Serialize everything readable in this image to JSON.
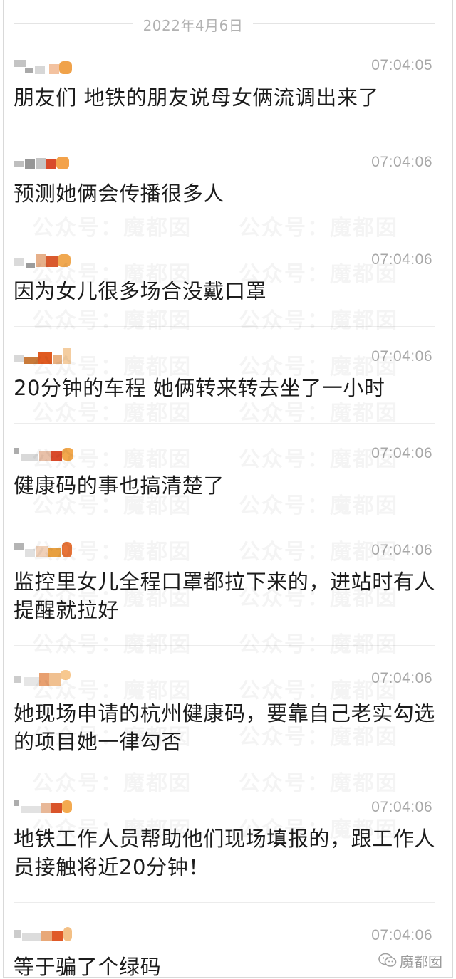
{
  "date_divider": "2022年4月6日",
  "watermark_text": "公众号：魔都囡",
  "corner_watermark": "魔都囡",
  "messages": [
    {
      "time": "07:04:05",
      "text": "朋友们 地铁的朋友说母女俩流调出来了"
    },
    {
      "time": "07:04:06",
      "text": "预测她俩会传播很多人"
    },
    {
      "time": "07:04:06",
      "text": "因为女儿很多场合没戴口罩"
    },
    {
      "time": "07:04:06",
      "text": "20分钟的车程 她俩转来转去坐了一小时"
    },
    {
      "time": "07:04:06",
      "text": "健康码的事也搞清楚了"
    },
    {
      "time": "07:04:06",
      "text": "监控里女儿全程口罩都拉下来的，进站时有人提醒就拉好"
    },
    {
      "time": "07:04:06",
      "text": "她现场申请的杭州健康码，要靠自己老实勾选的项目她一律勾否"
    },
    {
      "time": "07:04:06",
      "text": "地铁工作人员帮助他们现场填报的，跟工作人员接触将近20分钟！"
    },
    {
      "time": "07:04:06",
      "text": "等于骗了个绿码"
    }
  ],
  "colors": {
    "text": "#1c1c1c",
    "time": "#a8a8a8",
    "divider": "#ececec",
    "avatar_blur_orange": "#e8904a",
    "avatar_blur_red": "#d24a2a"
  },
  "icons": [
    "wechat-icon"
  ]
}
